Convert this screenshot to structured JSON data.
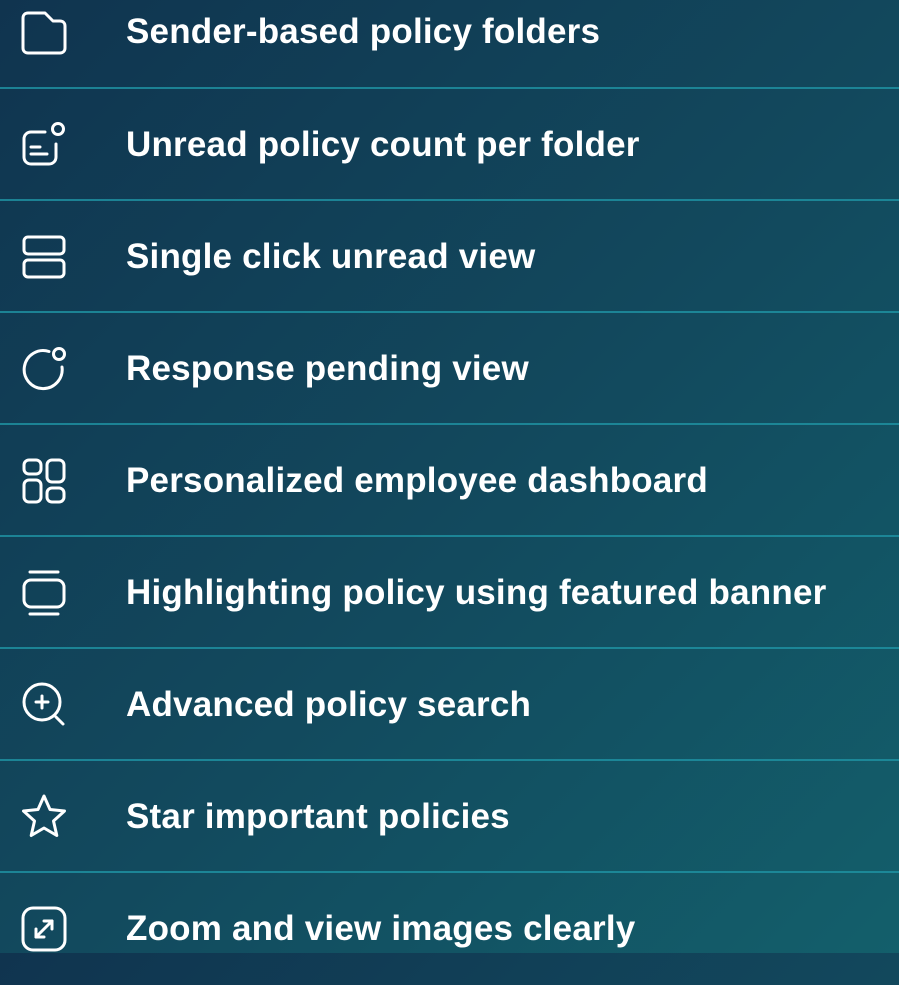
{
  "features": [
    {
      "label": "Sender-based policy folders",
      "icon": "folder-icon"
    },
    {
      "label": "Unread policy count per folder",
      "icon": "unread-count-icon"
    },
    {
      "label": "Single click unread view",
      "icon": "stacked-view-icon"
    },
    {
      "label": "Response pending view",
      "icon": "pending-circle-icon"
    },
    {
      "label": "Personalized employee dashboard",
      "icon": "dashboard-icon"
    },
    {
      "label": "Highlighting policy using featured banner",
      "icon": "banner-icon"
    },
    {
      "label": "Advanced policy search",
      "icon": "search-plus-icon"
    },
    {
      "label": "Star important policies",
      "icon": "star-icon"
    },
    {
      "label": "Zoom and view images clearly",
      "icon": "zoom-expand-icon"
    }
  ],
  "colors": {
    "background_start": "#10344f",
    "background_end": "#135f6b",
    "divider": "#1f8fa0",
    "text": "#ffffff"
  }
}
